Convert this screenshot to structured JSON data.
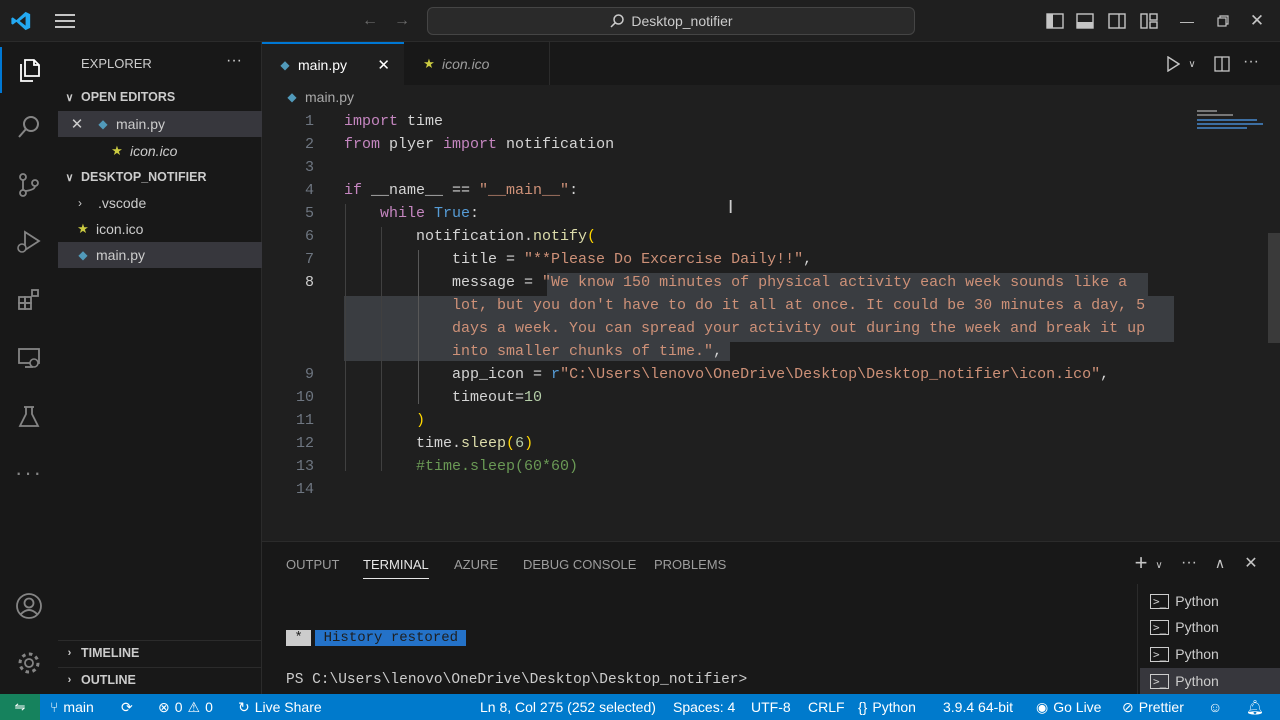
{
  "title_bar": {
    "search_text": "Desktop_notifier"
  },
  "sidebar": {
    "title": "EXPLORER",
    "open_editors_label": "OPEN EDITORS",
    "open_editors": [
      {
        "name": "main.py"
      },
      {
        "name": "icon.ico"
      }
    ],
    "folder_label": "DESKTOP_NOTIFIER",
    "files": [
      {
        "name": ".vscode"
      },
      {
        "name": "icon.ico"
      },
      {
        "name": "main.py"
      }
    ],
    "timeline_label": "TIMELINE",
    "outline_label": "OUTLINE"
  },
  "tabs": [
    {
      "label": "main.py"
    },
    {
      "label": "icon.ico"
    }
  ],
  "breadcrumb": "main.py",
  "editor": {
    "line_numbers": [
      "1",
      "2",
      "3",
      "4",
      "5",
      "6",
      "7",
      "8",
      "9",
      "10",
      "11",
      "12",
      "13",
      "14"
    ],
    "lines": [
      [
        {
          "t": "import",
          "c": "kc"
        },
        {
          "t": " time",
          "c": "w"
        }
      ],
      [
        {
          "t": "from",
          "c": "kc"
        },
        {
          "t": " plyer ",
          "c": "w"
        },
        {
          "t": "import",
          "c": "kc"
        },
        {
          "t": " notification",
          "c": "w"
        }
      ],
      [],
      [
        {
          "t": "if",
          "c": "kc"
        },
        {
          "t": " __name__ == ",
          "c": "w"
        },
        {
          "t": "\"__main__\"",
          "c": "s"
        },
        {
          "t": ":",
          "c": "w"
        }
      ],
      [
        {
          "t": "    while",
          "c": "kc"
        },
        {
          "t": " ",
          "c": "w"
        },
        {
          "t": "True",
          "c": "k"
        },
        {
          "t": ":",
          "c": "w"
        }
      ],
      [
        {
          "t": "        notification.",
          "c": "w"
        },
        {
          "t": "notify",
          "c": "f"
        },
        {
          "t": "(",
          "c": "p"
        }
      ],
      [
        {
          "t": "            title",
          "c": "w"
        },
        {
          "t": " = ",
          "c": "w"
        },
        {
          "t": "\"**Please Do Excercise Daily!!\"",
          "c": "s"
        },
        {
          "t": ",",
          "c": "w"
        }
      ],
      [
        {
          "t": "            message",
          "c": "w"
        },
        {
          "t": " = ",
          "c": "w"
        },
        {
          "t": "\"We know 150 minutes of physical activity each week sounds like a",
          "c": "s"
        }
      ],
      [
        {
          "t": "            lot, but you don't have to do it all at once. It could be 30 minutes a day, 5",
          "c": "s"
        }
      ],
      [
        {
          "t": "            days a week. You can spread your activity out during the week and break it up",
          "c": "s"
        }
      ],
      [
        {
          "t": "            into smaller chunks of time.\"",
          "c": "s"
        },
        {
          "t": ",",
          "c": "w"
        }
      ],
      [
        {
          "t": "            app_icon",
          "c": "w"
        },
        {
          "t": " = ",
          "c": "w"
        },
        {
          "t": "r",
          "c": "k"
        },
        {
          "t": "\"C:\\Users\\lenovo\\OneDrive\\Desktop\\Desktop_notifier\\icon.ico\"",
          "c": "s"
        },
        {
          "t": ",",
          "c": "w"
        }
      ],
      [
        {
          "t": "            timeout",
          "c": "w"
        },
        {
          "t": "=",
          "c": "w"
        },
        {
          "t": "10",
          "c": "n"
        }
      ],
      [
        {
          "t": "        )",
          "c": "p"
        }
      ],
      [
        {
          "t": "        time.",
          "c": "w"
        },
        {
          "t": "sleep",
          "c": "f"
        },
        {
          "t": "(",
          "c": "p"
        },
        {
          "t": "6",
          "c": "n"
        },
        {
          "t": ")",
          "c": "p"
        }
      ],
      [
        {
          "t": "        #time.sleep(60*60)",
          "c": "c"
        }
      ],
      []
    ]
  },
  "panel": {
    "tabs": [
      "OUTPUT",
      "TERMINAL",
      "AZURE",
      "DEBUG CONSOLE",
      "PROBLEMS"
    ],
    "history_marker": " * ",
    "history_text": " History restored ",
    "prompt": "PS C:\\Users\\lenovo\\OneDrive\\Desktop\\Desktop_notifier>",
    "terminals": [
      "Python",
      "Python",
      "Python",
      "Python"
    ]
  },
  "status_bar": {
    "branch": "main",
    "errors": "0",
    "warnings": "0",
    "live_share": "Live Share",
    "position": "Ln 8, Col 275 (252 selected)",
    "spaces": "Spaces: 4",
    "encoding": "UTF-8",
    "eol": "CRLF",
    "language": "Python",
    "interpreter": "3.9.4 64-bit",
    "go_live": "Go Live",
    "prettier": "Prettier"
  },
  "colors": {
    "accent": "#0078d4",
    "status_bar": "#007acc",
    "editor_bg": "#1f1f1f",
    "sidebar_bg": "#181818"
  }
}
